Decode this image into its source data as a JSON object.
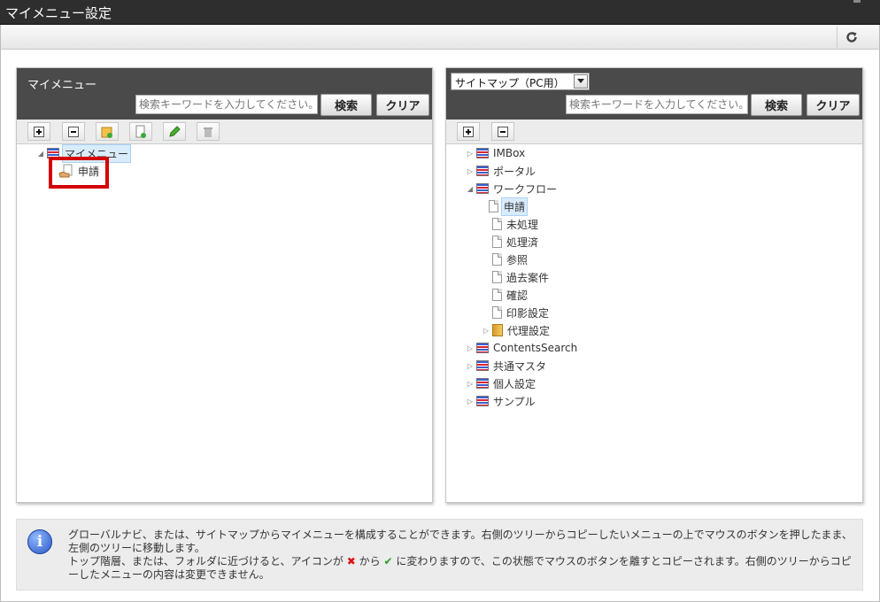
{
  "window": {
    "title": "マイメニュー設定"
  },
  "left_panel": {
    "title": "マイメニュー",
    "search_placeholder": "検索キーワードを入力してください。",
    "search_label": "検索",
    "clear_label": "クリア",
    "tree": [
      {
        "label": "マイメニュー",
        "icon": "list-icon",
        "expanded": true
      },
      {
        "label": "申請",
        "icon": "doc-hand-icon"
      }
    ]
  },
  "right_panel": {
    "select_value": "サイトマップ（PC用）",
    "search_placeholder": "検索キーワードを入力してください。",
    "search_label": "検索",
    "clear_label": "クリア",
    "tree": {
      "imbox": "IMBox",
      "portal": "ポータル",
      "workflow": "ワークフロー",
      "shinsei": "申請",
      "mishori": "未処理",
      "shorizumi": "処理済",
      "sansho": "参照",
      "kako": "過去案件",
      "kakunin": "確認",
      "inei": "印影設定",
      "dairi": "代理設定",
      "contents_search": "ContentsSearch",
      "kyotsu": "共通マスタ",
      "kojin": "個人設定",
      "sample": "サンプル"
    }
  },
  "info": {
    "line1": "グローバルナビ、または、サイトマップからマイメニューを構成することができます。右側のツリーからコピーしたいメニューの上でマウスのボタンを押したまま、左側のツリーに移動します。",
    "line2_a": "トップ階層、または、フォルダに近づけると、アイコンが",
    "line2_b": "から",
    "line2_c": "に変わりますので、この状態でマウスのボタンを離すとコピーされます。右側のツリーからコピーしたメニューの内容は変更できません。"
  }
}
